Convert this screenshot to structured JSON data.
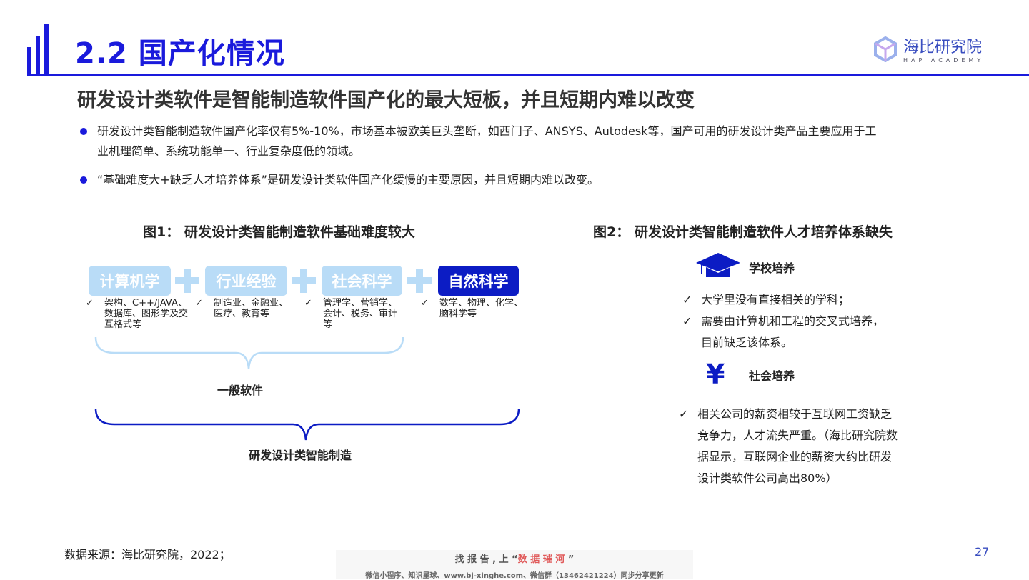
{
  "header": {
    "title": "2.2 国产化情况",
    "logo_name": "海比研究院",
    "logo_sub": "HAP ACADEMY"
  },
  "subtitle": "研发设计类软件是智能制造软件国产化的最大短板，并且短期内难以改变",
  "bullets": [
    "研发设计类智能制造软件国产化率仅有5%-10%，市场基本被欧美巨头垄断，如西门子、ANSYS、Autodesk等，国产可用的研发设计类产品主要应用于工业机理简单、系统功能单一、行业复杂度低的领域。",
    "“基础难度大+缺乏人才培养体系”是研发设计类软件国产化缓慢的主要原因，并且短期内难以改变。"
  ],
  "fig1": {
    "title": "图1：  研发设计类智能制造软件基础难度较大",
    "boxes": [
      {
        "label": "计算机学",
        "desc": "架构、C++/JAVA、数据库、图形学及交互格式等"
      },
      {
        "label": "行业经验",
        "desc": "制造业、金融业、医疗、教育等"
      },
      {
        "label": "社会科学",
        "desc": "管理学、营销学、会计、税务、审计等"
      },
      {
        "label": "自然科学",
        "desc": "数学、物理、化学、脑科学等"
      }
    ],
    "check": "✓",
    "brace1": "一般软件",
    "brace2": "研发设计类智能制造"
  },
  "fig2": {
    "title": "图2：  研发设计类智能制造软件人才培养体系缺失",
    "school": {
      "label": "学校培养",
      "items": [
        "大学里没有直接相关的学科；",
        "需要由计算机和工程的交叉式培养，目前缺乏该体系。"
      ]
    },
    "society": {
      "icon": "¥",
      "label": "社会培养",
      "items": [
        "相关公司的薪资相较于互联网工资缺乏竞争力，人才流失严重。（海比研究院数据显示，互联网企业的薪资大约比研发设计类软件公司高出80%）"
      ]
    }
  },
  "footer": {
    "source": "数据来源：海比研究院，2022；",
    "page": "27"
  },
  "watermark": {
    "line1a": "找 报 告 , 上 “",
    "line1b": "数 据 璀 河",
    "line1c": " ”",
    "line2": "微信小程序、知识星球、www.bj-xinghe.com、微信群（13462421224）同步分享更新"
  }
}
